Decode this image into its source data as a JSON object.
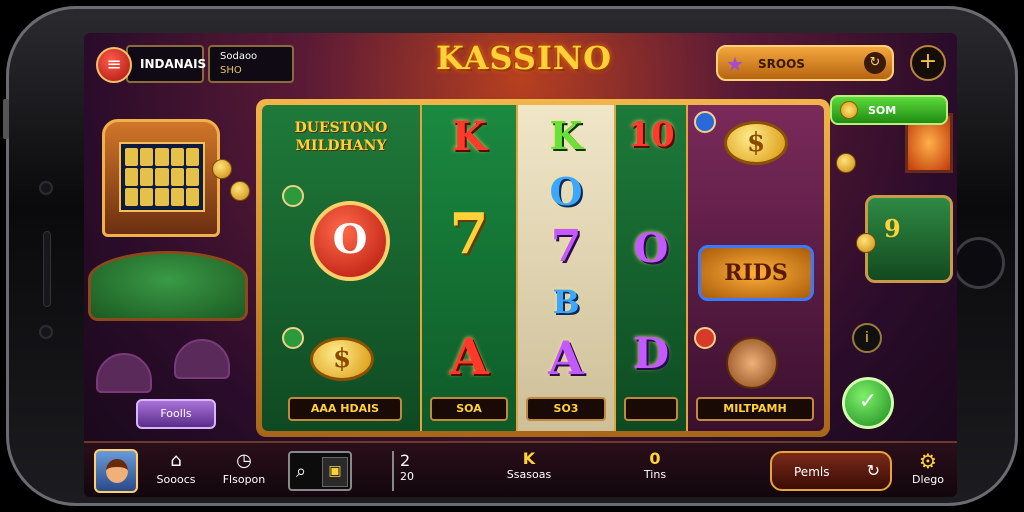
{
  "top": {
    "player_name": "INDANAIS",
    "balance_top": "Sodaoo",
    "balance_bottom": "SHO",
    "logo": "KASSINO",
    "coins_value": "SROOS",
    "green_pill": "SOM"
  },
  "reels": {
    "game_logo": "DUESTONO MILDHANY",
    "reel1": {
      "symbol": "O",
      "coin": "$",
      "label": "AAA HDAIS"
    },
    "reel2": {
      "symbols": [
        "K",
        "7",
        "A"
      ],
      "label": "SOA"
    },
    "reel3": {
      "symbols": [
        "K",
        "O",
        "7",
        "B",
        "A"
      ],
      "label": "SO3"
    },
    "reel4": {
      "symbols": [
        "10",
        "O",
        "D"
      ],
      "label": ""
    },
    "reel5": {
      "coin": "$",
      "badge": "RIDS",
      "label": "MILTPAMH"
    }
  },
  "left_decor": {
    "paytable_label": "Foolls",
    "machine_number": ""
  },
  "right_decor": {
    "machine_number": "9"
  },
  "bottom": {
    "nav": [
      {
        "icon": "home-icon",
        "label": "Sooocs"
      },
      {
        "icon": "clock-icon",
        "label": "Flsopon"
      }
    ],
    "bet_symbol": "2",
    "bet_value": "20",
    "stats": [
      {
        "num": "K",
        "label": "Ssasoas"
      },
      {
        "num": "0",
        "label": "Tins"
      }
    ],
    "bet_pill": "Pemls",
    "settings_label": "Dlego"
  }
}
